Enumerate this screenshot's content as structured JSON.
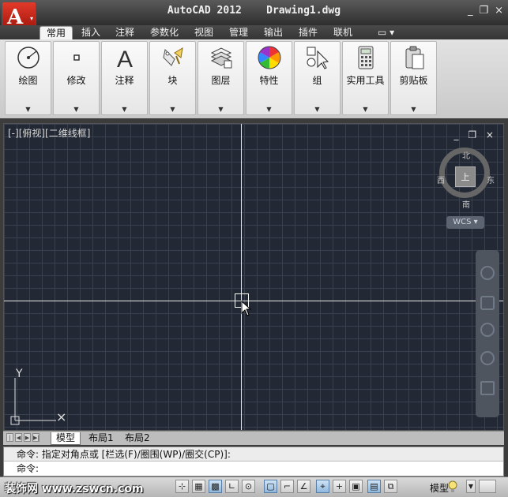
{
  "window": {
    "title": "AutoCAD 2012    Drawing1.dwg",
    "controls": [
      "_",
      "❐",
      "×"
    ]
  },
  "app_menu": {
    "logo_letter": "A",
    "dropdown": "▾"
  },
  "tabs": [
    {
      "label": "常用",
      "active": true
    },
    {
      "label": "插入"
    },
    {
      "label": "注释"
    },
    {
      "label": "参数化"
    },
    {
      "label": "视图"
    },
    {
      "label": "管理"
    },
    {
      "label": "输出"
    },
    {
      "label": "插件"
    },
    {
      "label": "联机"
    },
    {
      "label": "▭ ▾"
    }
  ],
  "ribbon_panels": [
    {
      "label": "绘图",
      "icon": "draw-circle-icon",
      "dropdown": "▼"
    },
    {
      "label": "修改",
      "icon": "modify-icon",
      "dropdown": "▼"
    },
    {
      "label": "注释",
      "icon": "annotation-icon",
      "dropdown": "▼"
    },
    {
      "label": "块",
      "icon": "block-icon",
      "dropdown": "▼"
    },
    {
      "label": "图层",
      "icon": "layers-icon",
      "dropdown": "▼"
    },
    {
      "label": "特性",
      "icon": "properties-color-wheel-icon",
      "dropdown": "▼"
    },
    {
      "label": "组",
      "icon": "group-icon",
      "dropdown": "▼"
    },
    {
      "label": "实用工具",
      "icon": "calculator-icon",
      "dropdown": "▼"
    },
    {
      "label": "剪贴板",
      "icon": "clipboard-icon",
      "dropdown": "▼"
    }
  ],
  "viewport": {
    "label": "[-][俯视][二维线框]",
    "controls": "_ ❐ ×",
    "background": "#222834"
  },
  "viewcube": {
    "top_face": "上",
    "north": "北",
    "south": "南",
    "east": "东",
    "west": "西",
    "wcs": "WCS ▾"
  },
  "ucs": {
    "y_label": "Y",
    "x_label": "×"
  },
  "layout_tabs": [
    {
      "label": "模型",
      "active": true
    },
    {
      "label": "布局1"
    },
    {
      "label": "布局2"
    }
  ],
  "command": {
    "history": "命令: 指定对角点或 [栏选(F)/圈围(WP)/圈交(CP)]:",
    "prompt": "命令:"
  },
  "status": {
    "watermark": "装饰网 www.zswcn.com",
    "model_label": "模型",
    "buttons": [
      "⊹",
      "▦",
      "▩",
      "∟",
      "⊙",
      "▢",
      "⌐",
      "∠",
      "⌖",
      "+",
      "▣",
      "▤",
      "⧉"
    ]
  }
}
